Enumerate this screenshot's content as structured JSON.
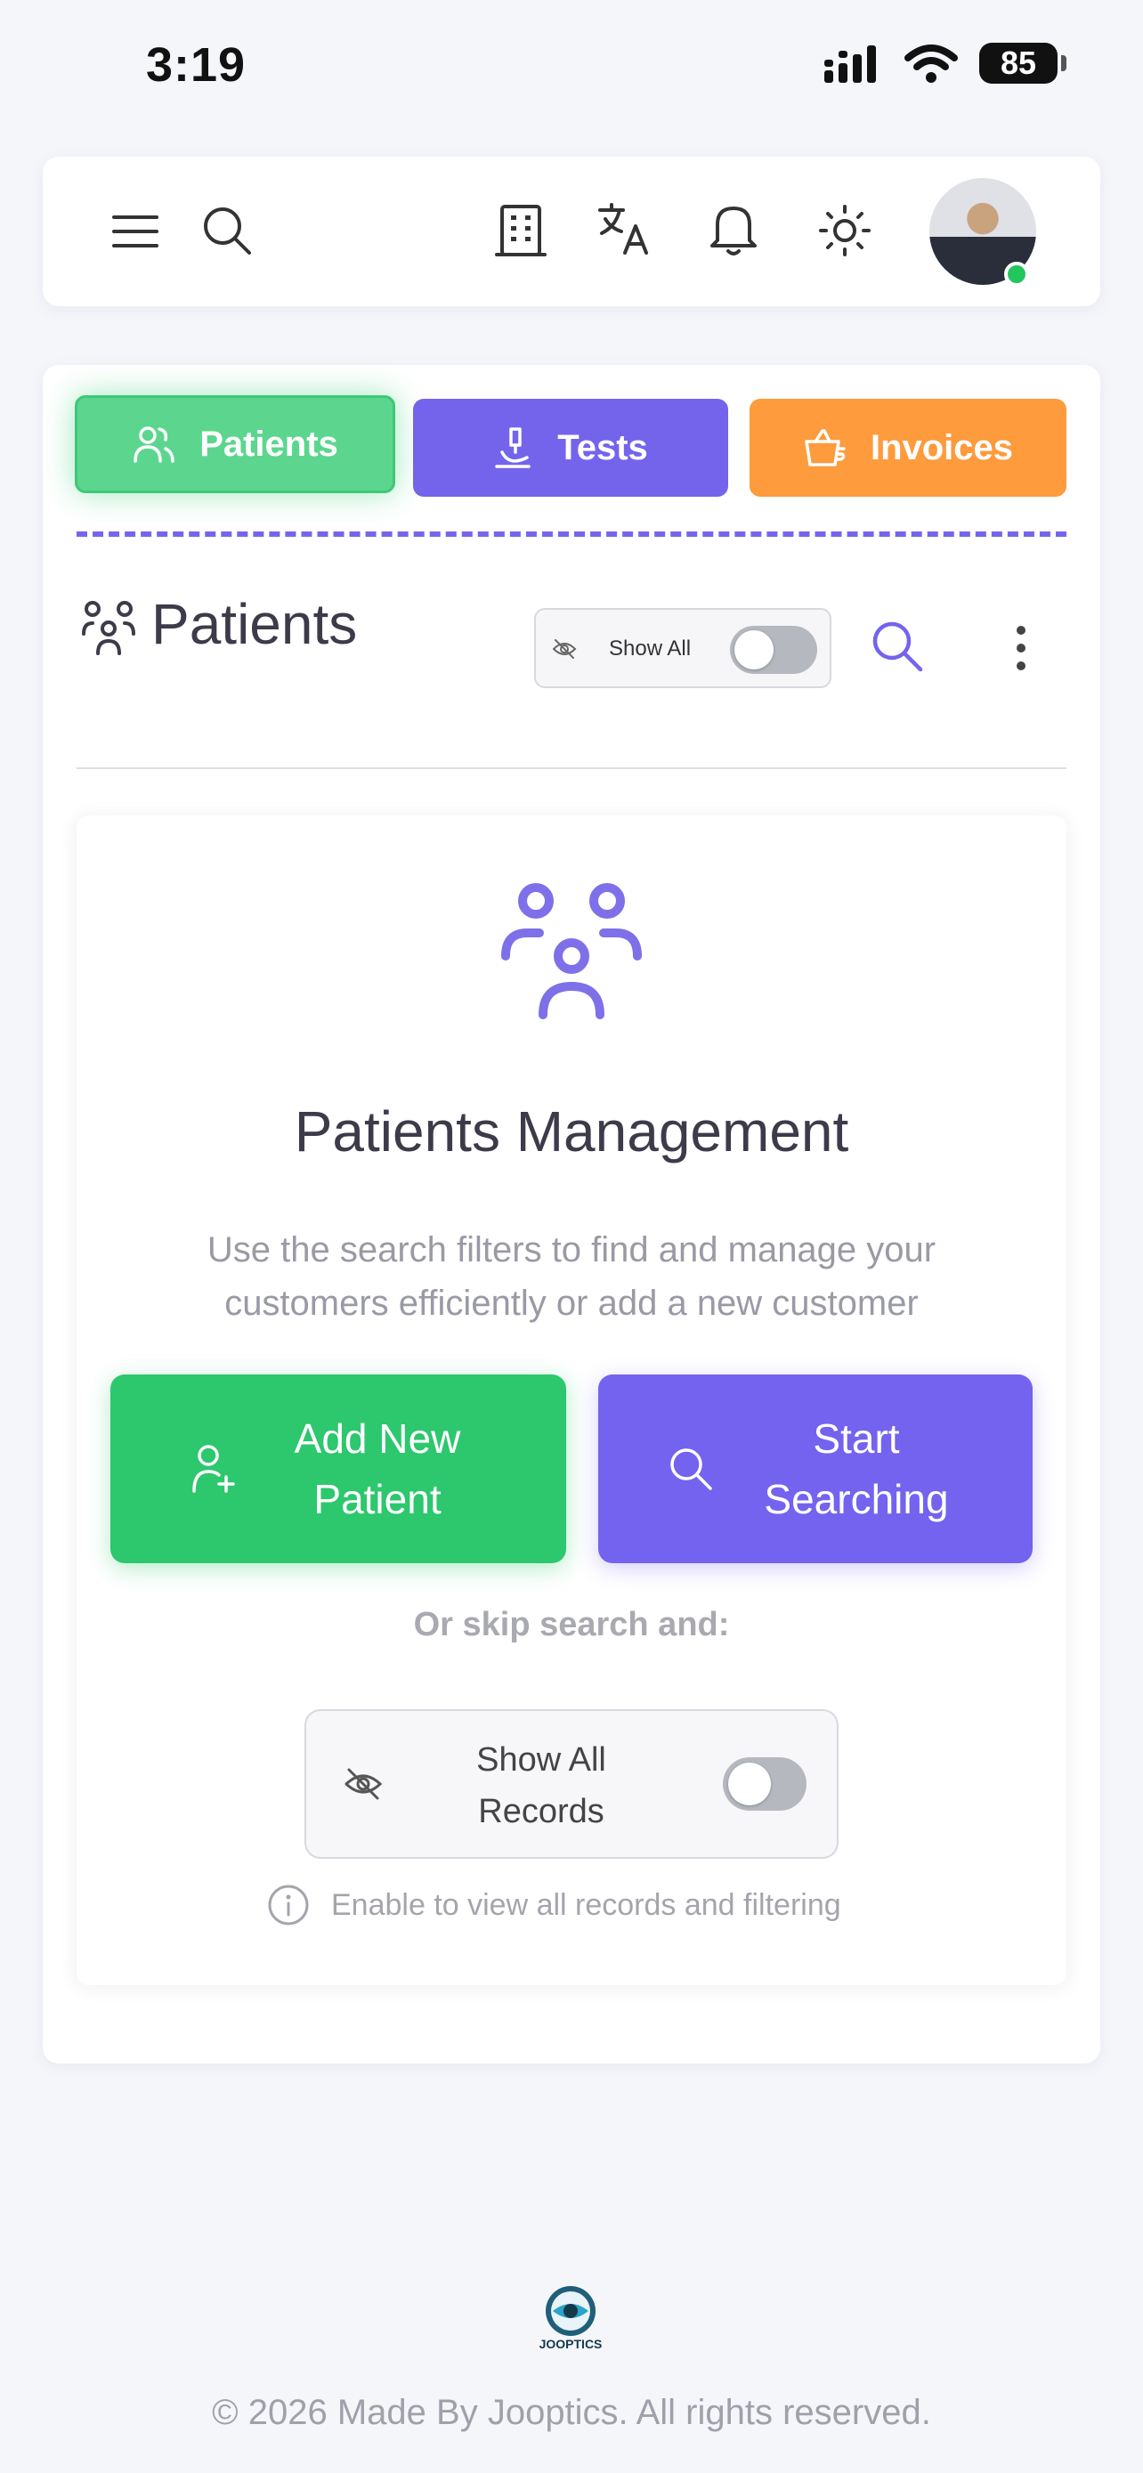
{
  "status_bar": {
    "time": "3:19",
    "battery": "85",
    "icons": [
      "signal-icon",
      "wifi-icon",
      "battery-icon"
    ]
  },
  "header": {
    "icons": [
      "menu-icon",
      "search-icon",
      "building-icon",
      "translate-icon",
      "bell-icon",
      "sun-icon"
    ],
    "avatar_status_color": "#22c55e"
  },
  "tabs": [
    {
      "label": "Patients",
      "icon": "users-icon",
      "color": "#5cd68e",
      "active": true
    },
    {
      "label": "Tests",
      "icon": "microscope-icon",
      "color": "#7464ec",
      "active": false
    },
    {
      "label": "Invoices",
      "icon": "basket-icon",
      "color": "#fd9b3d",
      "active": false
    }
  ],
  "section": {
    "title": "Patients",
    "show_all_label": "Show All",
    "show_all_enabled": false
  },
  "empty_state": {
    "title": "Patients Management",
    "description": "Use the search filters to find and manage your customers efficiently or add a new customer",
    "add_button": "Add New Patient",
    "search_button": "Start Searching",
    "skip_text": "Or skip search and:",
    "records_toggle_label": "Show All Records",
    "records_toggle_enabled": false,
    "hint": "Enable to view all records and filtering"
  },
  "footer": {
    "logo_text": "JOOPTICS",
    "copyright": "© 2026 Made By Jooptics. All rights reserved."
  },
  "colors": {
    "accent": "#7464ec",
    "green": "#2dc76d",
    "orange": "#fd9b3d"
  }
}
